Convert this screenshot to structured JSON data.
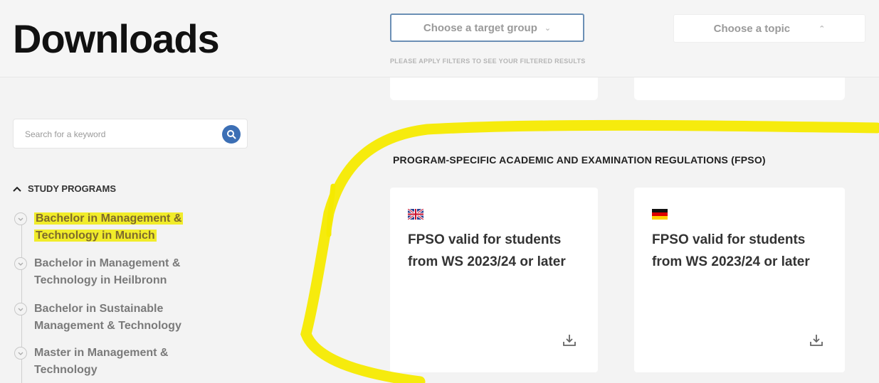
{
  "header": {
    "title": "Downloads",
    "target_group_select": "Choose a target group",
    "topic_select": "Choose a topic",
    "filter_hint": "PLEASE APPLY FILTERS TO SEE YOUR FILTERED RESULTS"
  },
  "search": {
    "placeholder": "Search for a keyword",
    "button_icon": "search-icon"
  },
  "sidebar": {
    "section_title": "STUDY PROGRAMS",
    "items": [
      {
        "label": "Bachelor in Management & Technology in Munich",
        "selected": true
      },
      {
        "label": "Bachelor in Management & Technology in Heilbronn"
      },
      {
        "label": "Bachelor in Sustainable Management & Technology"
      },
      {
        "label": "Master in Management & Technology"
      }
    ]
  },
  "main": {
    "section_title": "PROGRAM-SPECIFIC ACADEMIC AND EXAMINATION REGULATIONS (FPSO)",
    "cards": [
      {
        "flag": "uk-flag-icon",
        "text": "FPSO valid for students from WS 2023/24 or later",
        "action_icon": "download-icon"
      },
      {
        "flag": "germany-flag-icon",
        "text": "FPSO valid for students from WS 2023/24 or later",
        "action_icon": "download-icon"
      }
    ]
  },
  "colors": {
    "highlight": "#f1ec2a",
    "accent": "#3c6fb5",
    "annotation": "#f5ea00"
  }
}
